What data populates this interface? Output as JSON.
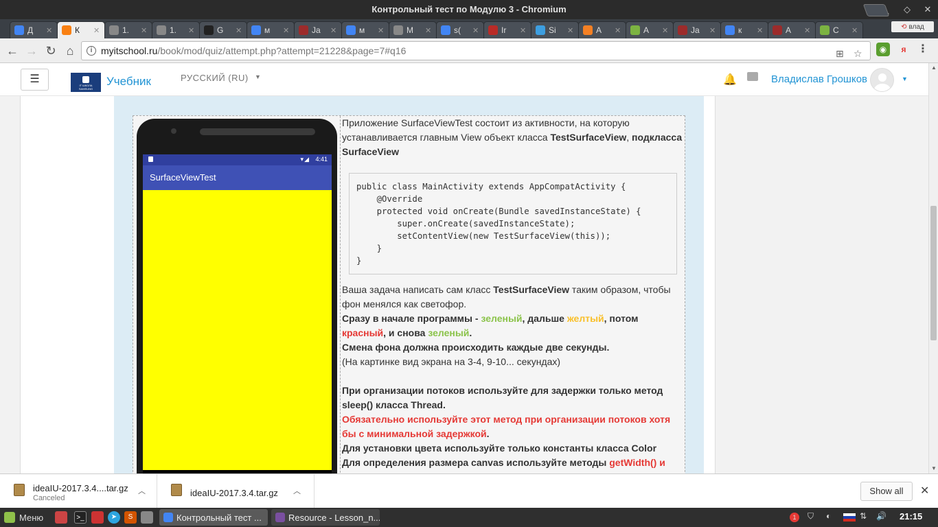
{
  "window": {
    "title": "Контрольный тест по Модулю 3 - Chromium"
  },
  "tabs": [
    {
      "label": "Д",
      "color": "#4285f4"
    },
    {
      "label": "К",
      "color": "#f98012"
    },
    {
      "label": "1.",
      "color": "#888888"
    },
    {
      "label": "1.",
      "color": "#888888"
    },
    {
      "label": "G",
      "color": "#222222"
    },
    {
      "label": "м",
      "color": "#4285f4"
    },
    {
      "label": "Ja",
      "color": "#9c2b2b"
    },
    {
      "label": "м",
      "color": "#4285f4"
    },
    {
      "label": "М",
      "color": "#888888"
    },
    {
      "label": "s(",
      "color": "#4285f4"
    },
    {
      "label": "Ir",
      "color": "#b92b27"
    },
    {
      "label": "Si",
      "color": "#3d9ee0"
    },
    {
      "label": "A",
      "color": "#f48024"
    },
    {
      "label": "A",
      "color": "#7cb342"
    },
    {
      "label": "Ja",
      "color": "#9c2b2b"
    },
    {
      "label": "к",
      "color": "#4285f4"
    },
    {
      "label": "A",
      "color": "#9c2b2b"
    },
    {
      "label": "C",
      "color": "#7cb342"
    }
  ],
  "profile": {
    "label": "влад"
  },
  "address": {
    "host": "myitschool.ru",
    "path": "/book/mod/quiz/attempt.php?attempt=21228&page=7#q16"
  },
  "site": {
    "name": "Учебник",
    "logo_text": "IT ШКОЛА SAMSUNG",
    "language": "РУССКИЙ (RU)",
    "user": "Владислав Грошков"
  },
  "phone": {
    "status_time": "4:41",
    "status_icons": "▾◢",
    "app_title": "SurfaceViewTest",
    "screen_color": "#ffff00"
  },
  "question": {
    "intro_plain": "Приложение SurfaceViewTest состоит из активности, на которую устанавливается главным View объект класса ",
    "intro_bold1": "TestSurfaceView",
    "intro_comma": ",",
    "intro_bold2": "подкласса SurfaceView",
    "code": "public class MainActivity extends AppCompatActivity {\n    @Override\n    protected void onCreate(Bundle savedInstanceState) {\n        super.onCreate(savedInstanceState);\n        setContentView(new TestSurfaceView(this));\n    }\n}",
    "task_1": "Ваша задача написать сам класс ",
    "task_bold": "TestSurfaceView",
    "task_2": " таким образом, чтобы фон менялся как светофор.",
    "seq_start": "Сразу в начале программы - ",
    "seq_green1": "зеленый",
    "seq_sep1": ", дальше ",
    "seq_yellow": "желтый",
    "seq_sep2": ", потом ",
    "seq_red": "красный",
    "seq_sep3": ", и снова ",
    "seq_green2": "зеленый",
    "seq_end": ".",
    "period": "Смена фона должна происходить каждые две секунды.",
    "hint": "(На картинке вид экрана на 3-4, 9-10... секундах)",
    "threads_1": "При организации потоков используйте для задержки только метод sleep() класса Thread.",
    "threads_red": "Обязательно используйте этот метод при организации потоков хотя бы с минимальной задержкой",
    "threads_dot": ".",
    "color_rule": "Для установки цвета используйте только константы класса Color",
    "canvas_1": "Для определения размера canvas используйте методы ",
    "canvas_red": "getWidth() и"
  },
  "downloads": [
    {
      "name": "ideaIU-2017.3.4....tar.gz",
      "status": "Canceled"
    },
    {
      "name": "ideaIU-2017.3.4.tar.gz",
      "status": ""
    }
  ],
  "downloads_show_all": "Show all",
  "taskbar": {
    "menu": "Меню",
    "tasks": [
      "Контрольный тест ...",
      "Resource - Lesson_n..."
    ],
    "clock": "21:15",
    "notif_count": "1"
  }
}
